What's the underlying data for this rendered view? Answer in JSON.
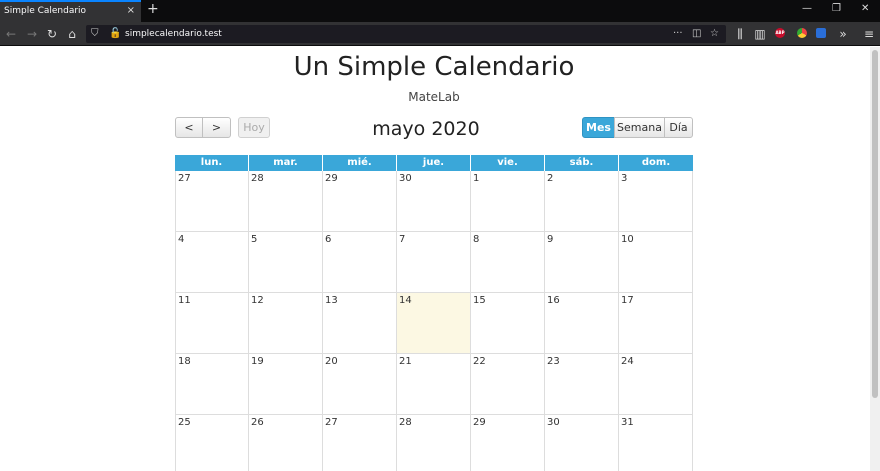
{
  "browser": {
    "tab_title": "Simple Calendario",
    "tab_close": "×",
    "new_tab": "+",
    "url": "simplecalendario.test",
    "minimize": "—",
    "restore": "❐",
    "close": "✕"
  },
  "page": {
    "title": "Un Simple Calendario",
    "subtitle": "MateLab"
  },
  "toolbar": {
    "prev": "<",
    "next": ">",
    "today": "Hoy",
    "month_label": "mayo 2020",
    "views": [
      "Mes",
      "Semana",
      "Día"
    ],
    "active_view": "Mes"
  },
  "calendar": {
    "day_headers": [
      "lun.",
      "mar.",
      "mié.",
      "jue.",
      "vie.",
      "sáb.",
      "dom."
    ],
    "weeks": [
      [
        "27",
        "28",
        "29",
        "30",
        "1",
        "2",
        "3"
      ],
      [
        "4",
        "5",
        "6",
        "7",
        "8",
        "9",
        "10"
      ],
      [
        "11",
        "12",
        "13",
        "14",
        "15",
        "16",
        "17"
      ],
      [
        "18",
        "19",
        "20",
        "21",
        "22",
        "23",
        "24"
      ],
      [
        "25",
        "26",
        "27",
        "28",
        "29",
        "30",
        "31"
      ]
    ],
    "today": "14",
    "colors": {
      "header": "#3aa7d9",
      "today": "#fcf8e3",
      "active_button": "#3aa7d9"
    }
  }
}
